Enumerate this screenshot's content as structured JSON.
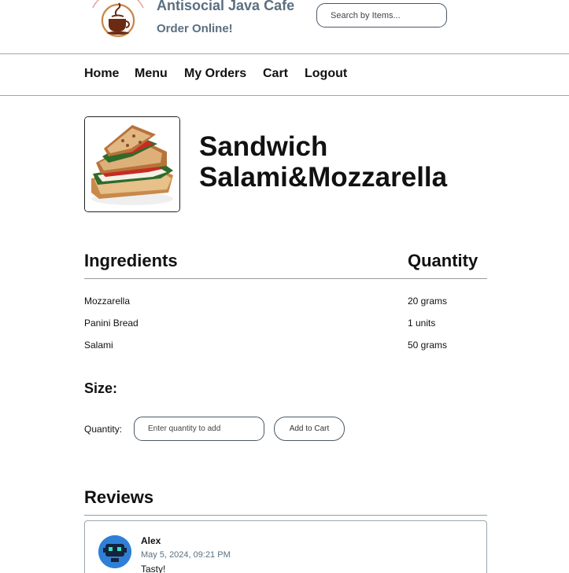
{
  "brand": {
    "name": "Antisocial Java Cafe",
    "tagline": "Order Online!"
  },
  "search": {
    "placeholder": "Search by Items..."
  },
  "nav": {
    "items": [
      "Home",
      "Menu",
      "My Orders",
      "Cart",
      "Logout"
    ]
  },
  "product": {
    "title": "Sandwich Salami&Mozzarella",
    "image_icon": "grilled-sandwich-photo"
  },
  "ingredients_table": {
    "headers": [
      "Ingredients",
      "Quantity"
    ],
    "rows": [
      {
        "name": "Mozzarella",
        "quantity": "20 grams"
      },
      {
        "name": "Panini Bread",
        "quantity": "1 units"
      },
      {
        "name": "Salami",
        "quantity": "50 grams"
      }
    ]
  },
  "order": {
    "size_label": "Size:",
    "quantity_label": "Quantity:",
    "quantity_placeholder": "Enter quantity to add",
    "add_button": "Add to Cart"
  },
  "reviews": {
    "title": "Reviews",
    "items": [
      {
        "user": "Alex",
        "date": "May 5, 2024, 09:21 PM",
        "text": "Tasty!",
        "avatar_icon": "robot-avatar"
      }
    ]
  },
  "colors": {
    "brand_text": "#5b6f80",
    "avatar_bg": "#2f7fd6",
    "border": "#4a5866"
  }
}
